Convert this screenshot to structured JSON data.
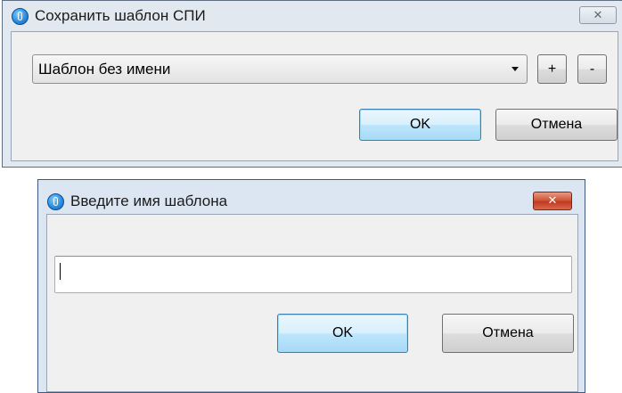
{
  "save_dialog": {
    "title": "Сохранить шаблон СПИ",
    "template_select": {
      "value": "Шаблон без имени"
    },
    "add_label": "+",
    "remove_label": "-",
    "ok_label": "OK",
    "cancel_label": "Отмена",
    "close_icon": "close-icon",
    "app_icon": "app-icon"
  },
  "name_dialog": {
    "title": "Введите имя шаблона",
    "name_input": {
      "value": "",
      "placeholder": ""
    },
    "ok_label": "OK",
    "cancel_label": "Отмена",
    "close_icon": "close-icon",
    "app_icon": "app-icon"
  },
  "colors": {
    "frame": "#dfe6ee",
    "client": "#f0f0f0",
    "default_button": "#bee6fd",
    "close_active": "#c0391f"
  }
}
